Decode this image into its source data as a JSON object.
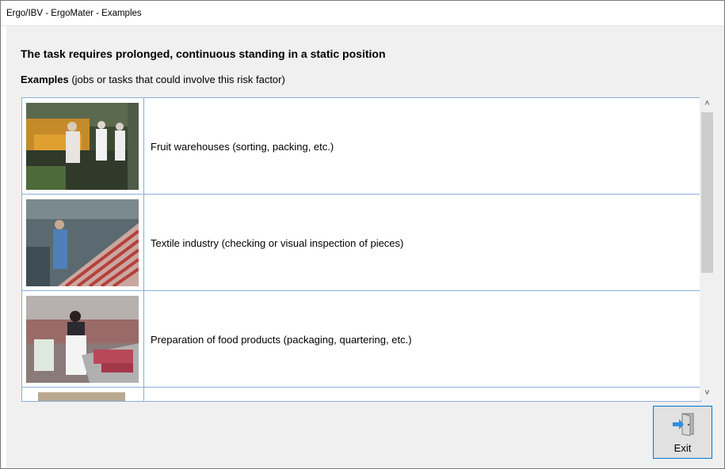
{
  "window": {
    "title": "Ergo/IBV - ErgoMater - Examples"
  },
  "heading": "The task requires prolonged, continuous standing in a static position",
  "subheading": {
    "bold": "Examples",
    "rest": "(jobs or tasks that could involve this risk factor)"
  },
  "examples": [
    {
      "label": "Fruit warehouses (sorting, packing, etc.)",
      "image": "photo-fruit-warehouse"
    },
    {
      "label": "Textile industry (checking or visual inspection of pieces)",
      "image": "photo-textile-industry"
    },
    {
      "label": "Preparation of food products (packaging, quartering, etc.)",
      "image": "photo-food-preparation"
    },
    {
      "label": "",
      "image": "photo-partial"
    }
  ],
  "scrollbar": {
    "up_glyph": "˄",
    "down_glyph": "˅"
  },
  "exit_button": {
    "label": "Exit",
    "icon": "exit-door-icon"
  },
  "colors": {
    "list_border": "#8aaedc",
    "button_focus_border": "#0078d7",
    "background": "#f0f0f0"
  }
}
